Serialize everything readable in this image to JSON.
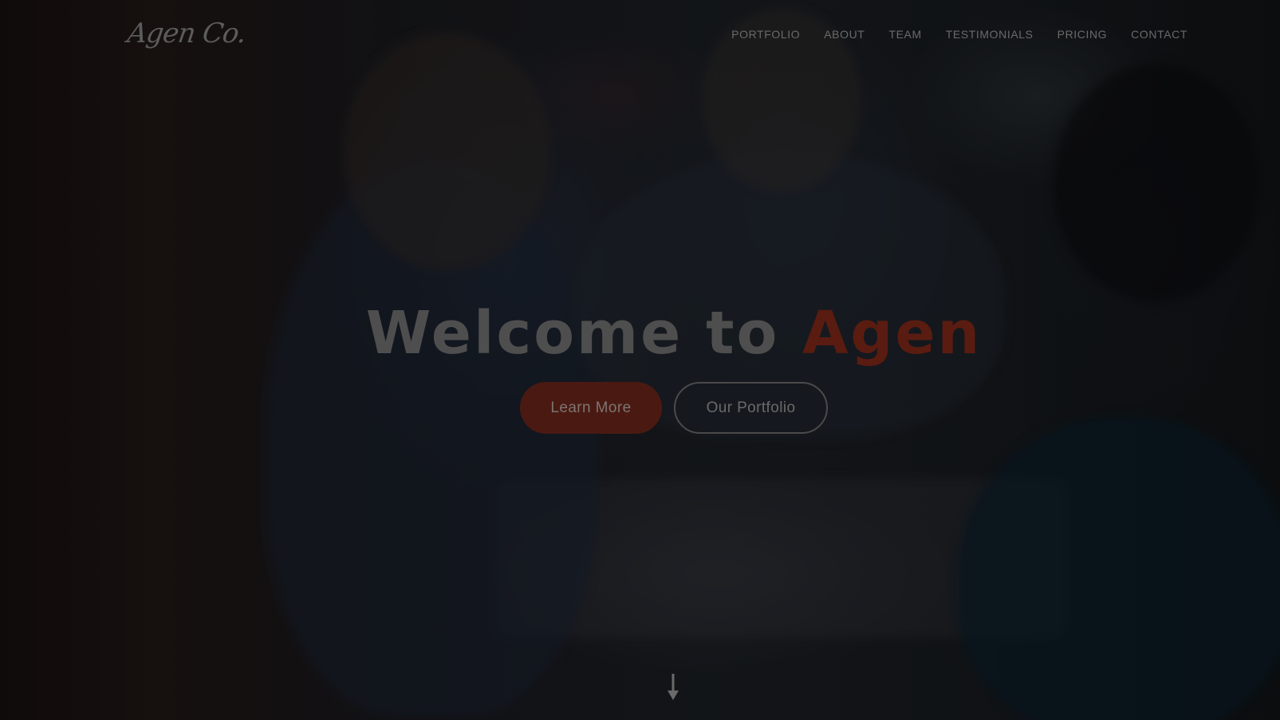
{
  "header": {
    "logo_text": "Agen Co.",
    "nav": [
      "PORTFOLIO",
      "ABOUT",
      "TEAM",
      "TESTIMONIALS",
      "PRICING",
      "CONTACT"
    ]
  },
  "hero": {
    "title_prefix": "Welcome to",
    "title_accent": "Agen",
    "primary_button": "Learn More",
    "secondary_button": "Our Portfolio",
    "scroll_icon": "arrow-down-icon"
  },
  "colors": {
    "accent": "#c0391f",
    "overlay": "#000000"
  }
}
